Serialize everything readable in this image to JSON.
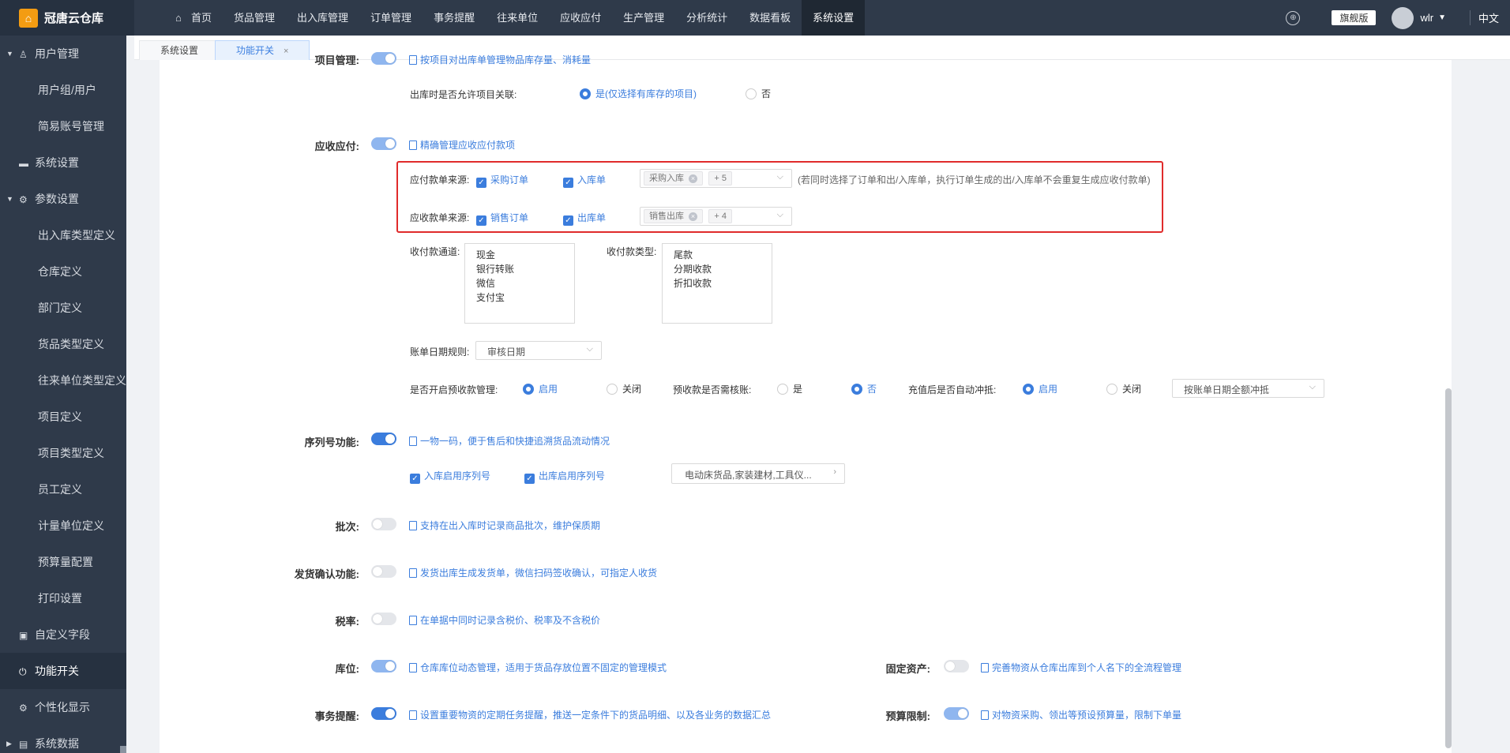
{
  "app": {
    "name": "冠唐云仓库"
  },
  "nav": [
    "首页",
    "货品管理",
    "出入库管理",
    "订单管理",
    "事务提醒",
    "往来单位",
    "应收应付",
    "生产管理",
    "分析统计",
    "数据看板",
    "系统设置"
  ],
  "top": {
    "edition": "旗舰版",
    "user": "wlr",
    "lang": "中文"
  },
  "sidebar": [
    {
      "label": "用户管理",
      "level": 1,
      "icon": "user-icon",
      "expanded": true
    },
    {
      "label": "用户组/用户",
      "level": 2
    },
    {
      "label": "简易账号管理",
      "level": 2
    },
    {
      "label": "系统设置",
      "level": 1,
      "icon": "monitor-icon"
    },
    {
      "label": "参数设置",
      "level": 1,
      "icon": "gear-icon",
      "expanded": true
    },
    {
      "label": "出入库类型定义",
      "level": 2
    },
    {
      "label": "仓库定义",
      "level": 2
    },
    {
      "label": "部门定义",
      "level": 2
    },
    {
      "label": "货品类型定义",
      "level": 2
    },
    {
      "label": "往来单位类型定义",
      "level": 2
    },
    {
      "label": "项目定义",
      "level": 2
    },
    {
      "label": "项目类型定义",
      "level": 2
    },
    {
      "label": "员工定义",
      "level": 2
    },
    {
      "label": "计量单位定义",
      "level": 2
    },
    {
      "label": "预算量配置",
      "level": 2
    },
    {
      "label": "打印设置",
      "level": 2
    },
    {
      "label": "自定义字段",
      "level": 1,
      "icon": "form-icon"
    },
    {
      "label": "功能开关",
      "level": 1,
      "icon": "power-icon",
      "active": true
    },
    {
      "label": "个性化显示",
      "level": 1,
      "icon": "gear-icon"
    },
    {
      "label": "系统数据",
      "level": 1,
      "icon": "database-icon"
    }
  ],
  "tabs": {
    "t1": "系统设置",
    "t2": "功能开关",
    "close": "×"
  },
  "project": {
    "label": "项目管理:",
    "desc": "按项目对出库单管理物品库存量、消耗量",
    "out_link_label": "出库时是否允许项目关联:",
    "opt_yes": "是(仅选择有库存的项目)",
    "opt_no": "否"
  },
  "ar": {
    "label": "应收应付:",
    "desc": "精确管理应收应付款项",
    "pay_src_label": "应付款单来源:",
    "pay_cb1": "采购订单",
    "pay_cb2": "入库单",
    "pay_tag": "采购入库",
    "pay_more": "+ 5",
    "pay_hint": "(若同时选择了订单和出/入库单，执行订单生成的出/入库单不会重复生成应收付款单)",
    "rec_src_label": "应收款单来源:",
    "rec_cb1": "销售订单",
    "rec_cb2": "出库单",
    "rec_tag": "销售出库",
    "rec_more": "+ 4",
    "channel_label": "收付款通道:",
    "channels": [
      "现金",
      "银行转账",
      "微信",
      "支付宝"
    ],
    "type_label": "收付款类型:",
    "types": [
      "尾款",
      "分期收款",
      "折扣收款"
    ],
    "date_rule_label": "账单日期规则:",
    "date_rule_value": "审核日期",
    "prepay_label": "是否开启预收款管理:",
    "prepay_on": "启用",
    "prepay_off": "关闭",
    "audit_label": "预收款是否需核账:",
    "audit_yes": "是",
    "audit_no": "否",
    "offset_label": "充值后是否自动冲抵:",
    "offset_on": "启用",
    "offset_off": "关闭",
    "offset_select": "按账单日期全额冲抵"
  },
  "serial": {
    "label": "序列号功能:",
    "desc": "一物一码，便于售后和快捷追溯货品流动情况",
    "in_cb": "入库启用序列号",
    "out_cb": "出库启用序列号",
    "cat_select": "电动床货品,家装建材,工具仪..."
  },
  "batch": {
    "label": "批次:",
    "desc": "支持在出入库时记录商品批次，维护保质期"
  },
  "delivery": {
    "label": "发货确认功能:",
    "desc": "发货出库生成发货单，微信扫码签收确认，可指定人收货"
  },
  "tax": {
    "label": "税率:",
    "desc": "在单据中同时记录含税价、税率及不含税价"
  },
  "location": {
    "label": "库位:",
    "desc": "仓库库位动态管理，适用于货品存放位置不固定的管理模式"
  },
  "fixed_asset": {
    "label": "固定资产:",
    "desc": "完善物资从仓库出库到个人名下的全流程管理"
  },
  "reminder": {
    "label": "事务提醒:",
    "desc": "设置重要物资的定期任务提醒，推送一定条件下的货品明细、以及各业务的数据汇总"
  },
  "budget": {
    "label": "预算限制:",
    "desc": "对物资采购、领出等预设预算量，限制下单量"
  }
}
